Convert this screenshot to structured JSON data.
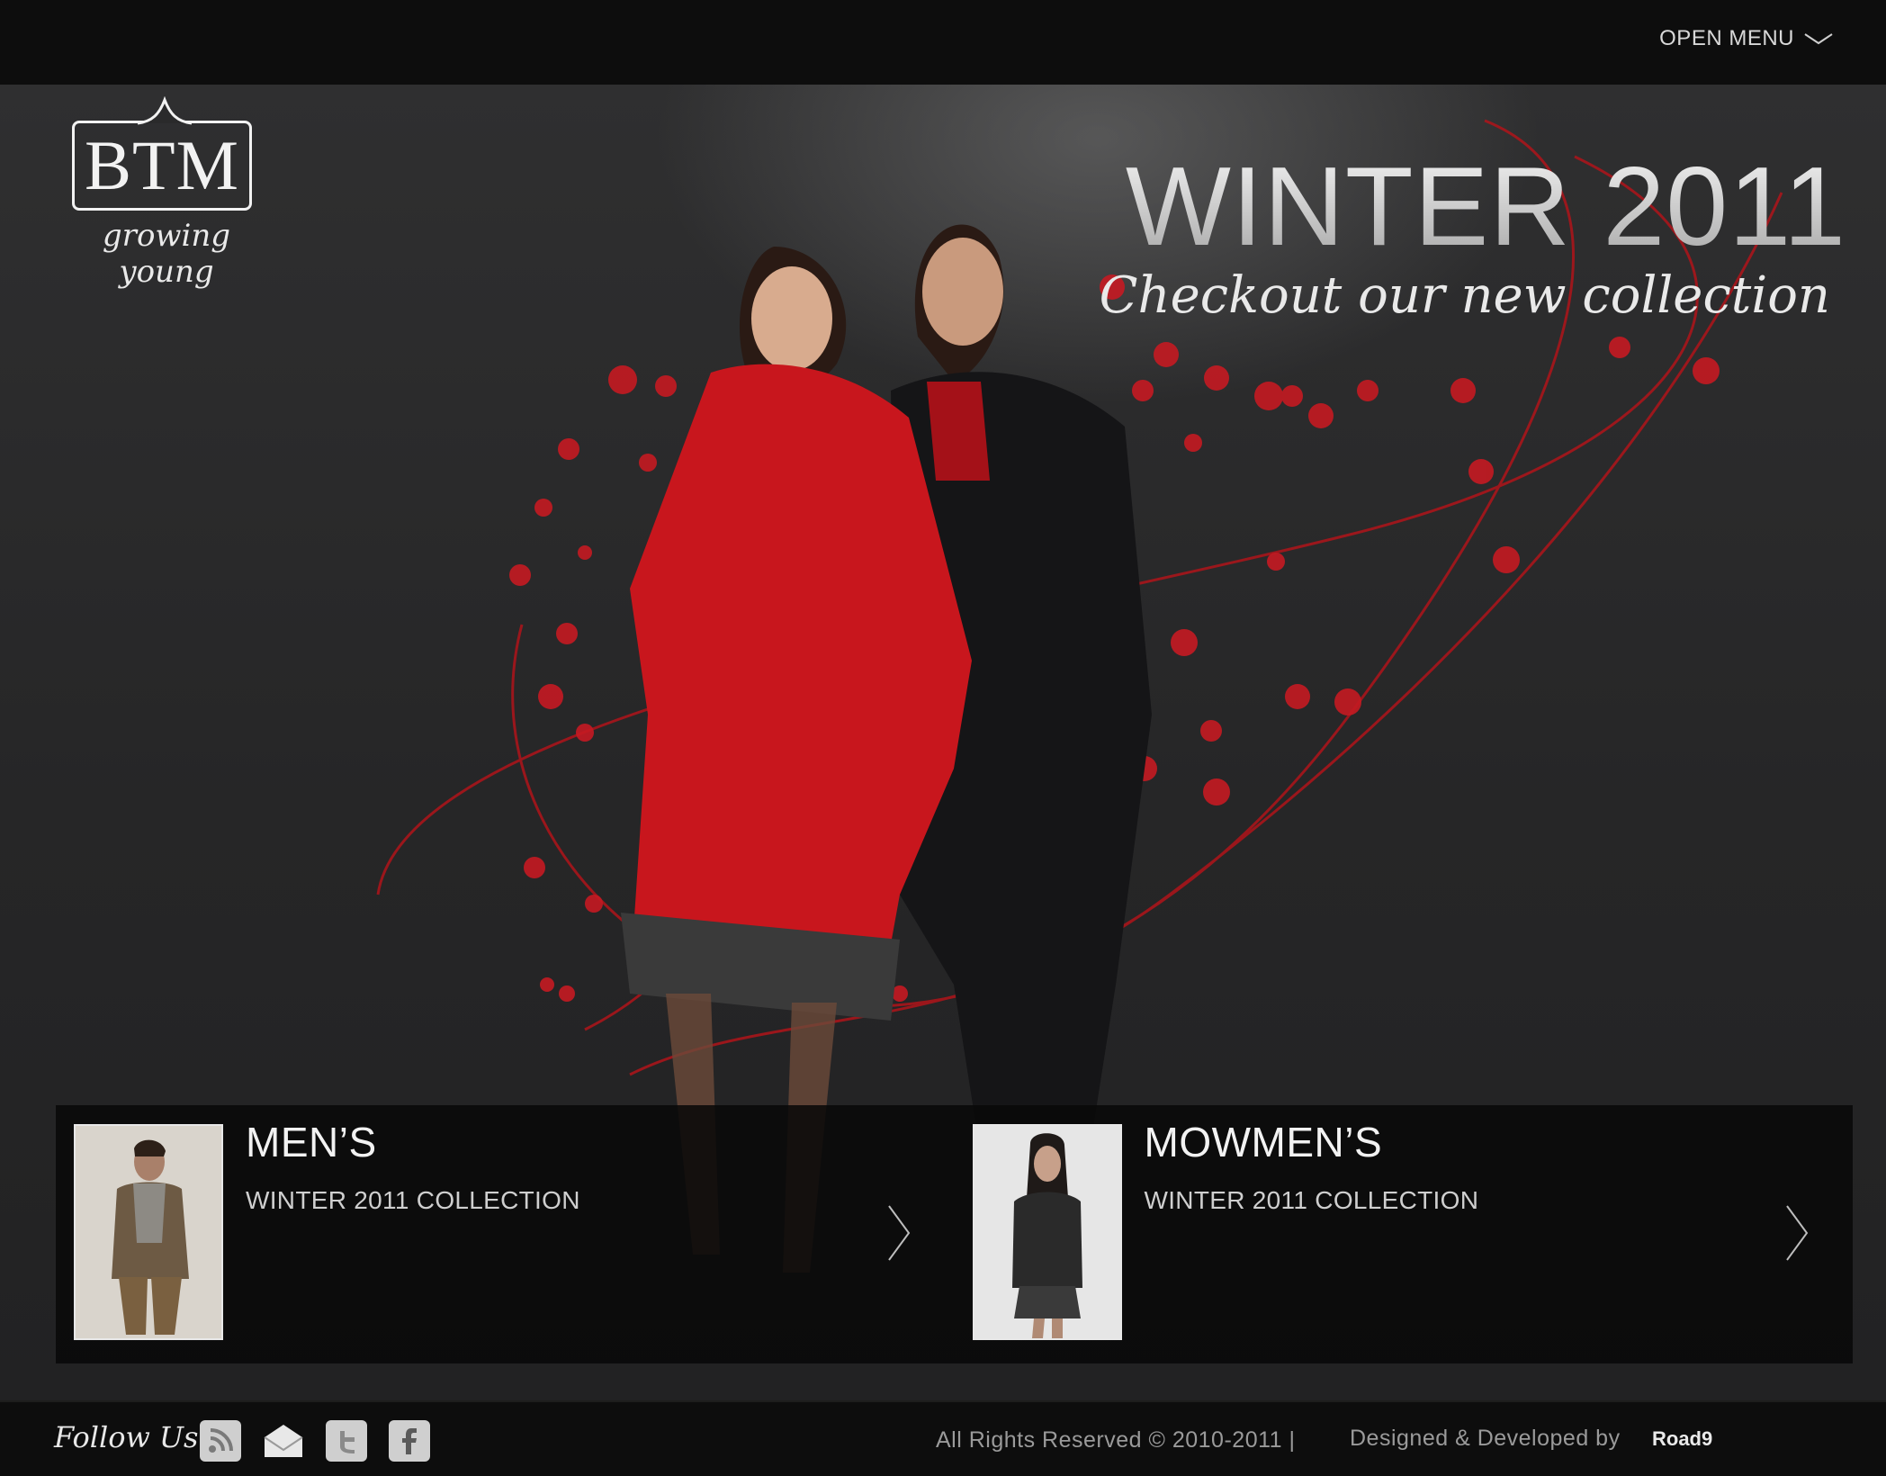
{
  "topbar": {
    "menu_label": "OPEN MENU",
    "menu_icon": "chevron-down-icon"
  },
  "logo": {
    "name": "BTM",
    "tagline": "growing young"
  },
  "hero": {
    "title": "WINTER 2011",
    "subtitle": "Checkout our new collection"
  },
  "cards": [
    {
      "title": "MEN’S",
      "subtitle": "WINTER 2011 COLLECTION",
      "arrow_icon": "chevron-right-icon"
    },
    {
      "title": "MOWMEN’S",
      "subtitle": "WINTER 2011 COLLECTION",
      "arrow_icon": "chevron-right-icon"
    }
  ],
  "footer": {
    "follow_label": "Follow Us",
    "social": [
      "rss-icon",
      "mail-icon",
      "twitter-icon",
      "facebook-icon"
    ],
    "copyright": "All Rights Reserved ©  2010-2011   |",
    "credit": "Designed & Developed by",
    "credit_brand": "Road9"
  },
  "colors": {
    "accent_red": "#c8161d",
    "bg_dark": "#0d0d0d"
  }
}
